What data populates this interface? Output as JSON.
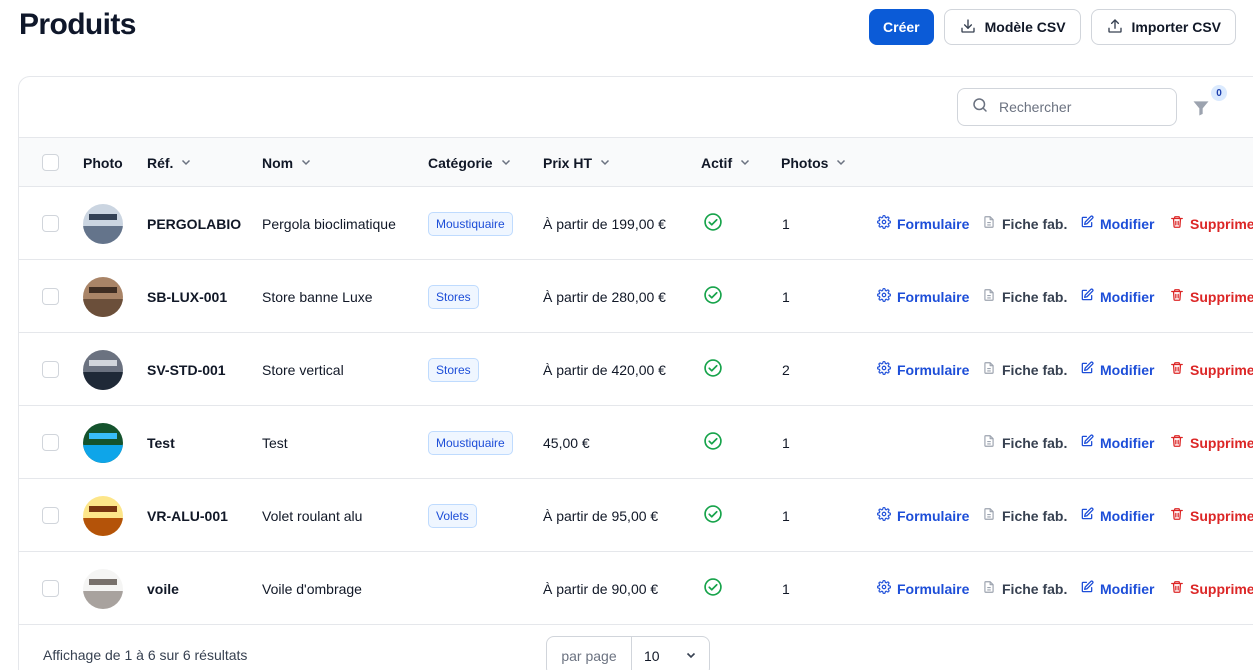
{
  "page": {
    "title": "Produits"
  },
  "header": {
    "create_label": "Créer",
    "csv_template_label": "Modèle CSV",
    "import_csv_label": "Importer CSV"
  },
  "toolbar": {
    "search_placeholder": "Rechercher",
    "filter_count": "0"
  },
  "table": {
    "columns": [
      "Photo",
      "Réf.",
      "Nom",
      "Catégorie",
      "Prix HT",
      "Actif",
      "Photos"
    ],
    "action_labels": {
      "form": "Formulaire",
      "sheet": "Fiche fab.",
      "edit": "Modifier",
      "delete": "Supprimer"
    },
    "rows": [
      {
        "ref": "PERGOLABIO",
        "name": "Pergola bioclimatique",
        "category": "Moustiquaire",
        "price": "À partir de 199,00 €",
        "active": true,
        "photos": "1",
        "has_form": true
      },
      {
        "ref": "SB-LUX-001",
        "name": "Store banne Luxe",
        "category": "Stores",
        "price": "À partir de 280,00 €",
        "active": true,
        "photos": "1",
        "has_form": true
      },
      {
        "ref": "SV-STD-001",
        "name": "Store vertical",
        "category": "Stores",
        "price": "À partir de 420,00 €",
        "active": true,
        "photos": "2",
        "has_form": true
      },
      {
        "ref": "Test",
        "name": "Test",
        "category": "Moustiquaire",
        "price": "45,00 €",
        "active": true,
        "photos": "1",
        "has_form": false
      },
      {
        "ref": "VR-ALU-001",
        "name": "Volet roulant alu",
        "category": "Volets",
        "price": "À partir de 95,00 €",
        "active": true,
        "photos": "1",
        "has_form": true
      },
      {
        "ref": "voile",
        "name": "Voile d'ombrage",
        "category": "",
        "price": "À partir de 90,00 €",
        "active": true,
        "photos": "1",
        "has_form": true
      }
    ]
  },
  "footer": {
    "summary": "Affichage de 1 à 6 sur 6 résultats",
    "per_page_label": "par page",
    "per_page_value": "10"
  },
  "colors": {
    "primary": "#0b5bd7",
    "link": "#1d4ed8",
    "danger": "#dc2626",
    "success": "#16a34a"
  }
}
